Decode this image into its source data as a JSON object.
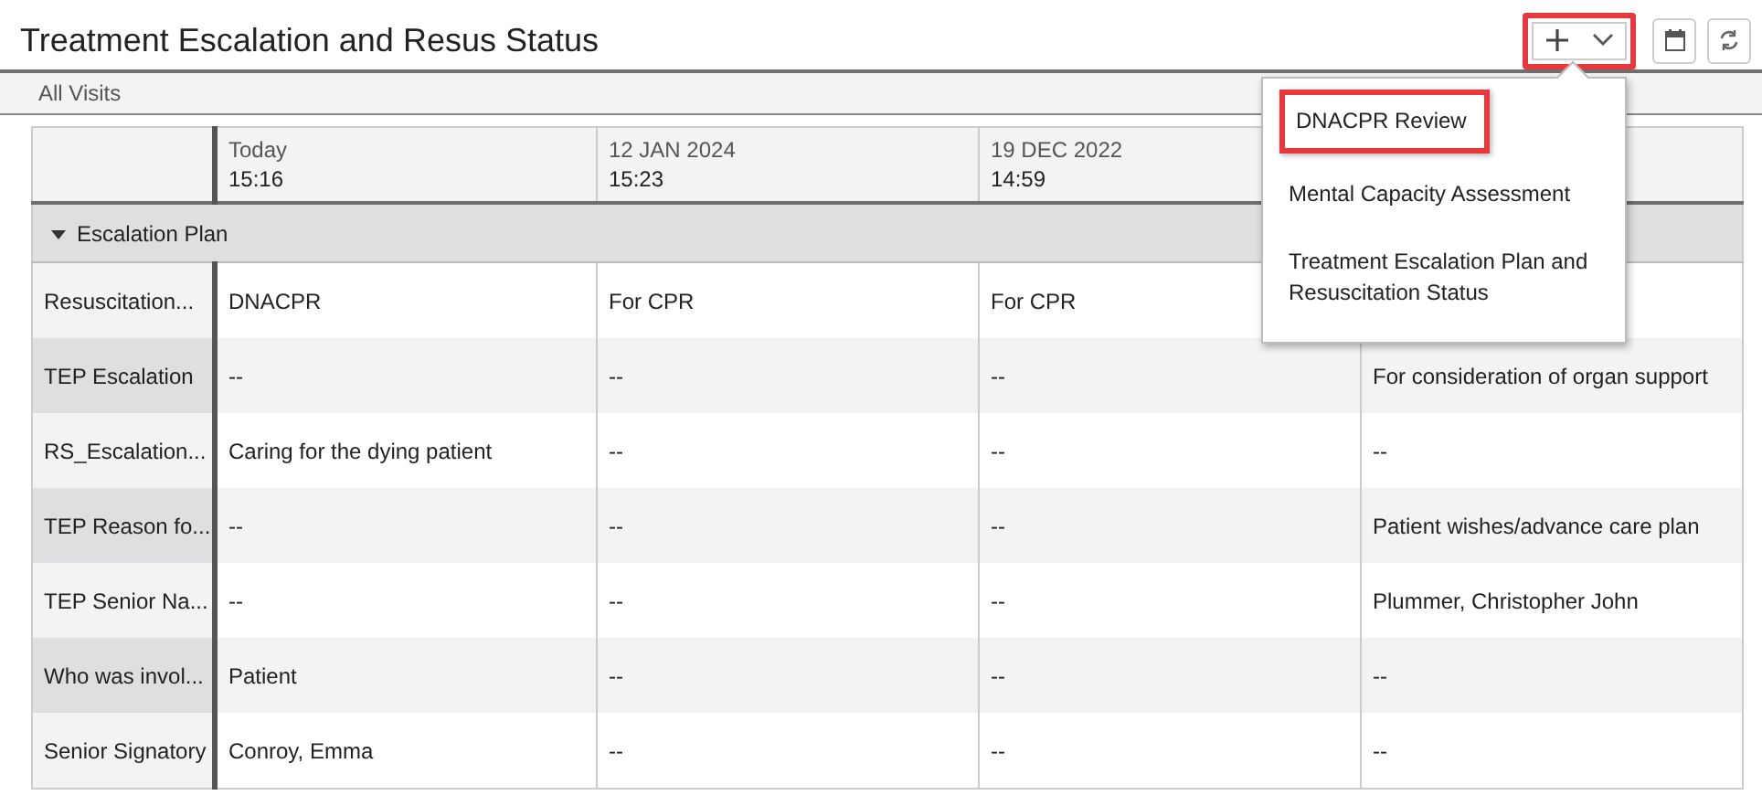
{
  "title": "Treatment Escalation and Resus Status",
  "toolbar": {
    "add_button": {
      "highlighted": true
    },
    "add_menu": {
      "expanded": true,
      "items": [
        {
          "label": "DNACPR Review",
          "highlighted": true
        },
        {
          "label": "Mental Capacity Assessment",
          "highlighted": false
        },
        {
          "label": "Treatment Escalation Plan and Resuscitation Status",
          "highlighted": false
        }
      ]
    }
  },
  "filter_bar": {
    "label": "All Visits"
  },
  "table": {
    "columns": [
      {
        "date": "Today",
        "time": "15:16"
      },
      {
        "date": "12 JAN 2024",
        "time": "15:23"
      },
      {
        "date": "19 DEC 2022",
        "time": "14:59"
      }
    ],
    "group": {
      "label": "Escalation Plan",
      "expanded": true
    },
    "rows": [
      {
        "label": "Resuscitation...",
        "cells": [
          "DNACPR",
          "For CPR",
          "For CPR"
        ]
      },
      {
        "label": "TEP Escalation",
        "cells": [
          "--",
          "--",
          "--",
          "For consideration of organ support"
        ]
      },
      {
        "label": "RS_Escalation...",
        "cells": [
          "Caring for the dying patient",
          "--",
          "--",
          "--"
        ]
      },
      {
        "label": "TEP Reason fo...",
        "cells": [
          "--",
          "--",
          "--",
          "Patient wishes/advance care plan"
        ]
      },
      {
        "label": "TEP Senior Na...",
        "cells": [
          "--",
          "--",
          "--",
          "Plummer, Christopher John"
        ]
      },
      {
        "label": "Who was invol...",
        "cells": [
          "Patient",
          "--",
          "--",
          "--"
        ]
      },
      {
        "label": "Senior Signatory",
        "cells": [
          "Conroy, Emma",
          "--",
          "--",
          "--"
        ]
      }
    ]
  }
}
